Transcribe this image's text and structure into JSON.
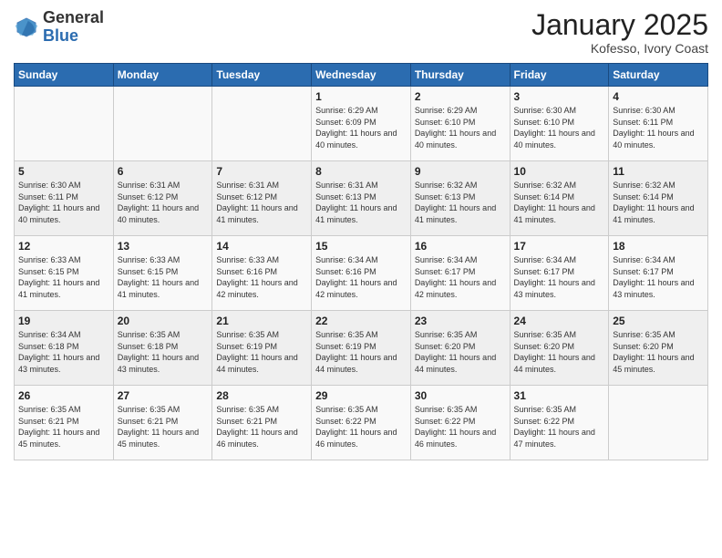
{
  "header": {
    "logo_general": "General",
    "logo_blue": "Blue",
    "month_title": "January 2025",
    "location": "Kofesso, Ivory Coast"
  },
  "weekdays": [
    "Sunday",
    "Monday",
    "Tuesday",
    "Wednesday",
    "Thursday",
    "Friday",
    "Saturday"
  ],
  "weeks": [
    [
      {
        "day": "",
        "content": ""
      },
      {
        "day": "",
        "content": ""
      },
      {
        "day": "",
        "content": ""
      },
      {
        "day": "1",
        "content": "Sunrise: 6:29 AM\nSunset: 6:09 PM\nDaylight: 11 hours and 40 minutes."
      },
      {
        "day": "2",
        "content": "Sunrise: 6:29 AM\nSunset: 6:10 PM\nDaylight: 11 hours and 40 minutes."
      },
      {
        "day": "3",
        "content": "Sunrise: 6:30 AM\nSunset: 6:10 PM\nDaylight: 11 hours and 40 minutes."
      },
      {
        "day": "4",
        "content": "Sunrise: 6:30 AM\nSunset: 6:11 PM\nDaylight: 11 hours and 40 minutes."
      }
    ],
    [
      {
        "day": "5",
        "content": "Sunrise: 6:30 AM\nSunset: 6:11 PM\nDaylight: 11 hours and 40 minutes."
      },
      {
        "day": "6",
        "content": "Sunrise: 6:31 AM\nSunset: 6:12 PM\nDaylight: 11 hours and 40 minutes."
      },
      {
        "day": "7",
        "content": "Sunrise: 6:31 AM\nSunset: 6:12 PM\nDaylight: 11 hours and 41 minutes."
      },
      {
        "day": "8",
        "content": "Sunrise: 6:31 AM\nSunset: 6:13 PM\nDaylight: 11 hours and 41 minutes."
      },
      {
        "day": "9",
        "content": "Sunrise: 6:32 AM\nSunset: 6:13 PM\nDaylight: 11 hours and 41 minutes."
      },
      {
        "day": "10",
        "content": "Sunrise: 6:32 AM\nSunset: 6:14 PM\nDaylight: 11 hours and 41 minutes."
      },
      {
        "day": "11",
        "content": "Sunrise: 6:32 AM\nSunset: 6:14 PM\nDaylight: 11 hours and 41 minutes."
      }
    ],
    [
      {
        "day": "12",
        "content": "Sunrise: 6:33 AM\nSunset: 6:15 PM\nDaylight: 11 hours and 41 minutes."
      },
      {
        "day": "13",
        "content": "Sunrise: 6:33 AM\nSunset: 6:15 PM\nDaylight: 11 hours and 41 minutes."
      },
      {
        "day": "14",
        "content": "Sunrise: 6:33 AM\nSunset: 6:16 PM\nDaylight: 11 hours and 42 minutes."
      },
      {
        "day": "15",
        "content": "Sunrise: 6:34 AM\nSunset: 6:16 PM\nDaylight: 11 hours and 42 minutes."
      },
      {
        "day": "16",
        "content": "Sunrise: 6:34 AM\nSunset: 6:17 PM\nDaylight: 11 hours and 42 minutes."
      },
      {
        "day": "17",
        "content": "Sunrise: 6:34 AM\nSunset: 6:17 PM\nDaylight: 11 hours and 43 minutes."
      },
      {
        "day": "18",
        "content": "Sunrise: 6:34 AM\nSunset: 6:17 PM\nDaylight: 11 hours and 43 minutes."
      }
    ],
    [
      {
        "day": "19",
        "content": "Sunrise: 6:34 AM\nSunset: 6:18 PM\nDaylight: 11 hours and 43 minutes."
      },
      {
        "day": "20",
        "content": "Sunrise: 6:35 AM\nSunset: 6:18 PM\nDaylight: 11 hours and 43 minutes."
      },
      {
        "day": "21",
        "content": "Sunrise: 6:35 AM\nSunset: 6:19 PM\nDaylight: 11 hours and 44 minutes."
      },
      {
        "day": "22",
        "content": "Sunrise: 6:35 AM\nSunset: 6:19 PM\nDaylight: 11 hours and 44 minutes."
      },
      {
        "day": "23",
        "content": "Sunrise: 6:35 AM\nSunset: 6:20 PM\nDaylight: 11 hours and 44 minutes."
      },
      {
        "day": "24",
        "content": "Sunrise: 6:35 AM\nSunset: 6:20 PM\nDaylight: 11 hours and 44 minutes."
      },
      {
        "day": "25",
        "content": "Sunrise: 6:35 AM\nSunset: 6:20 PM\nDaylight: 11 hours and 45 minutes."
      }
    ],
    [
      {
        "day": "26",
        "content": "Sunrise: 6:35 AM\nSunset: 6:21 PM\nDaylight: 11 hours and 45 minutes."
      },
      {
        "day": "27",
        "content": "Sunrise: 6:35 AM\nSunset: 6:21 PM\nDaylight: 11 hours and 45 minutes."
      },
      {
        "day": "28",
        "content": "Sunrise: 6:35 AM\nSunset: 6:21 PM\nDaylight: 11 hours and 46 minutes."
      },
      {
        "day": "29",
        "content": "Sunrise: 6:35 AM\nSunset: 6:22 PM\nDaylight: 11 hours and 46 minutes."
      },
      {
        "day": "30",
        "content": "Sunrise: 6:35 AM\nSunset: 6:22 PM\nDaylight: 11 hours and 46 minutes."
      },
      {
        "day": "31",
        "content": "Sunrise: 6:35 AM\nSunset: 6:22 PM\nDaylight: 11 hours and 47 minutes."
      },
      {
        "day": "",
        "content": ""
      }
    ]
  ]
}
